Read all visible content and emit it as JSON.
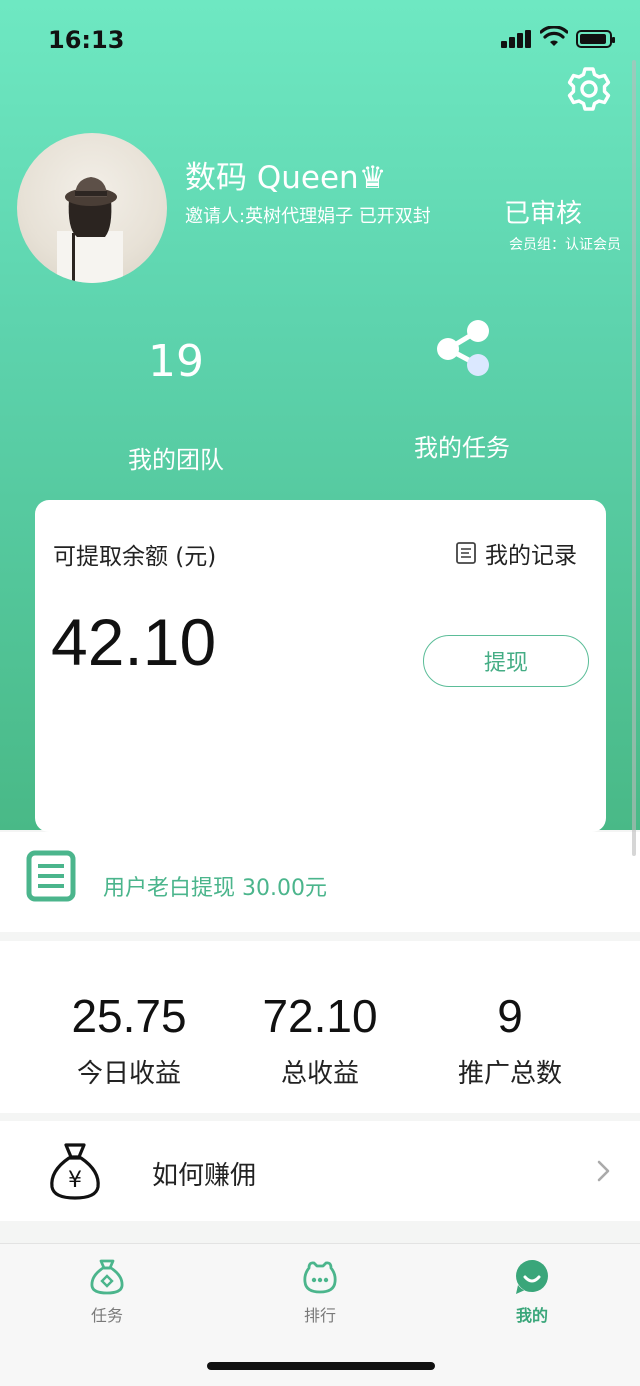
{
  "status_bar": {
    "time": "16:13"
  },
  "profile": {
    "nickname": "数码 Queen♛",
    "inviter": "邀请人:英树代理娟子 已开双封",
    "audit_status": "已审核",
    "member_group": "会员组：认证会员"
  },
  "quick": {
    "team_count": "19",
    "team_label": "我的团队",
    "task_label": "我的任务"
  },
  "balance_card": {
    "title": "可提取余额 (元)",
    "records_label": "我的记录",
    "amount": "42.10",
    "withdraw_label": "提现"
  },
  "notice": {
    "text": "用户老白提现 30.00元"
  },
  "stats": [
    {
      "value": "25.75",
      "label": "今日收益"
    },
    {
      "value": "72.10",
      "label": "总收益"
    },
    {
      "value": "9",
      "label": "推广总数"
    }
  ],
  "howto": {
    "label": "如何赚佣"
  },
  "tabs": [
    {
      "label": "任务",
      "icon": "task-bag-icon",
      "active": false
    },
    {
      "label": "排行",
      "icon": "ranking-icon",
      "active": false
    },
    {
      "label": "我的",
      "icon": "profile-icon",
      "active": true
    }
  ],
  "colors": {
    "accent": "#4bb58c",
    "tab_inactive": "#7a7a7a",
    "tab_active": "#3aa67a"
  }
}
